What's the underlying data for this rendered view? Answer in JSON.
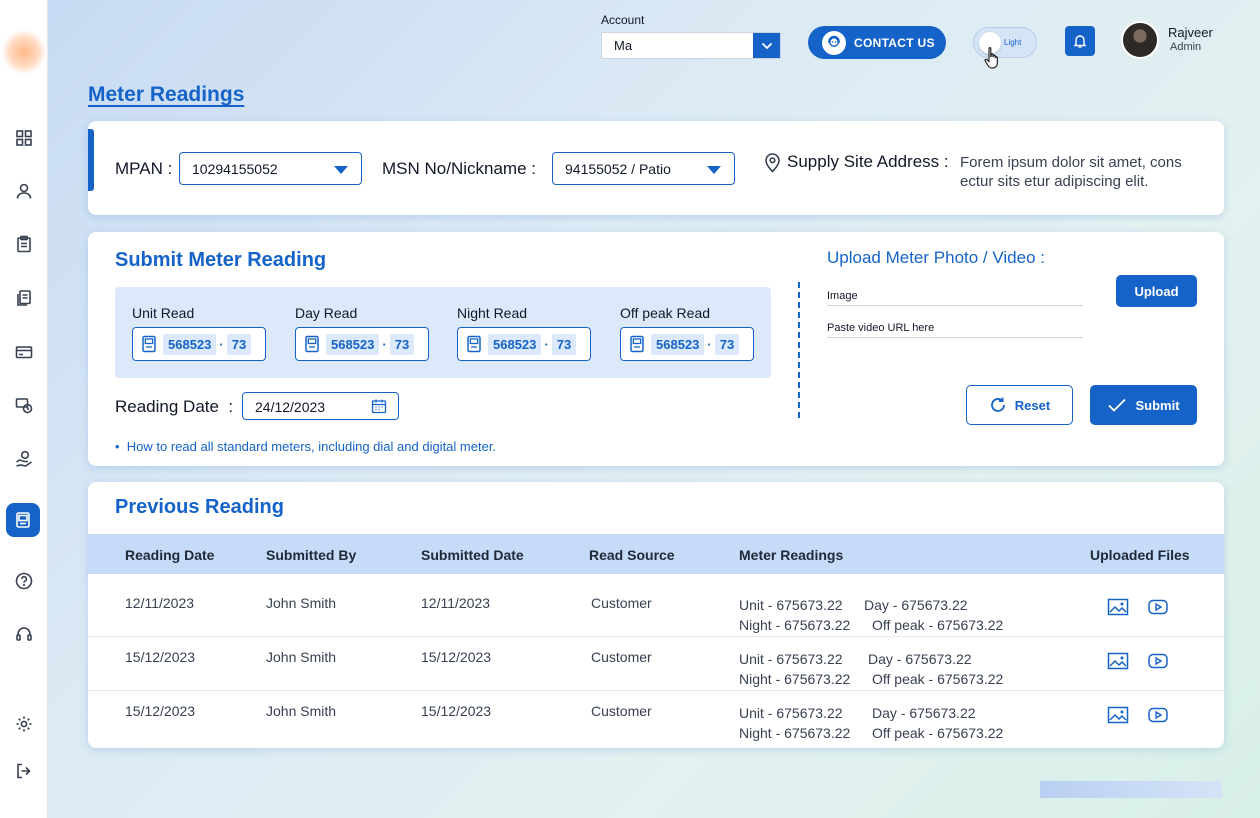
{
  "account": {
    "label": "Account",
    "value": "Ma"
  },
  "header": {
    "contact_label": "CONTACT US",
    "theme_toggle_label": "Light",
    "user_name": "Rajveer",
    "user_role": "Admin"
  },
  "page": {
    "title": "Meter Readings"
  },
  "meter_info": {
    "mpan_label": "MPAN :",
    "mpan_value": "10294155052",
    "msn_label": "MSN No/Nickname :",
    "msn_value": "94155052 / Patio",
    "address_label": "Supply Site Address :",
    "address_value": "Forem ipsum dolor sit amet, cons ectur sits etur adipiscing elit."
  },
  "submit": {
    "title": "Submit Meter Reading",
    "reads": [
      {
        "label": "Unit Read",
        "main": "568523",
        "decimal": "73"
      },
      {
        "label": "Day Read",
        "main": "568523",
        "decimal": "73"
      },
      {
        "label": "Night Read",
        "main": "568523",
        "decimal": "73"
      },
      {
        "label": "Off peak Read",
        "main": "568523",
        "decimal": "73"
      }
    ],
    "date_label": "Reading Date",
    "date_colon": ":",
    "date_value": "24/12/2023",
    "howto_link": "How to read all standard meters, including dial and digital meter.",
    "upload_title": "Upload Meter Photo / Video :",
    "image_field": "Image",
    "video_field": "Paste video URL here",
    "upload_button": "Upload",
    "reset_button": "Reset",
    "submit_button": "Submit"
  },
  "previous": {
    "title": "Previous Reading",
    "columns": [
      "Reading Date",
      "Submitted By",
      "Submitted Date",
      "Read Source",
      "Meter Readings",
      "Uploaded Files"
    ],
    "rows": [
      {
        "reading_date": "12/11/2023",
        "submitted_by": "John Smith",
        "submitted_date": "12/11/2023",
        "read_source": "Customer",
        "unit": "Unit - 675673.22",
        "day": "Day - 675673.22",
        "night": "Night - 675673.22",
        "offpeak": "Off peak - 675673.22"
      },
      {
        "reading_date": "15/12/2023",
        "submitted_by": "John Smith",
        "submitted_date": "15/12/2023",
        "read_source": "Customer",
        "unit": "Unit - 675673.22",
        "day": "Day - 675673.22",
        "night": "Night - 675673.22",
        "offpeak": "Off peak - 675673.22"
      },
      {
        "reading_date": "15/12/2023",
        "submitted_by": "John Smith",
        "submitted_date": "15/12/2023",
        "read_source": "Customer",
        "unit": "Unit - 675673.22",
        "day": "Day - 675673.22",
        "night": "Night - 675673.22",
        "offpeak": "Off peak - 675673.22"
      }
    ]
  },
  "colors": {
    "primary": "#1563c9",
    "header_row": "#c5dbf8",
    "read_box": "#dce9fa"
  },
  "icons": {
    "sidebar": [
      "dashboard-icon",
      "user-icon",
      "clipboard-icon",
      "documents-icon",
      "card-icon",
      "billing-clock-icon",
      "hand-coin-icon",
      "meter-icon",
      "help-icon",
      "headset-icon",
      "settings-icon",
      "logout-icon"
    ]
  }
}
